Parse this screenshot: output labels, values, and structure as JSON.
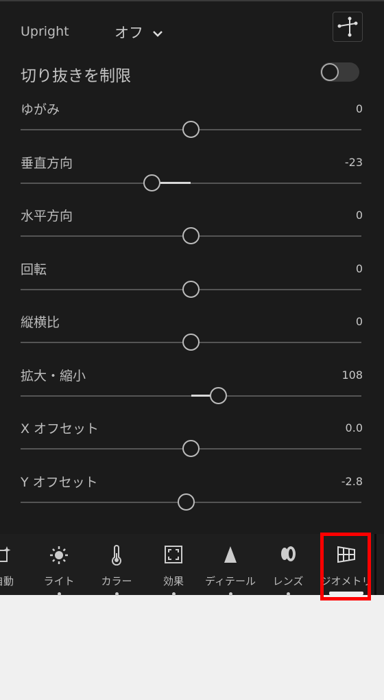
{
  "upright": {
    "label": "Upright",
    "value": "オフ"
  },
  "constrain_crop": {
    "label": "切り抜きを制限",
    "on": false
  },
  "sliders": [
    {
      "label": "ゆがみ",
      "value": "0",
      "num": 0,
      "min": -100,
      "max": 100
    },
    {
      "label": "垂直方向",
      "value": "-23",
      "num": -23,
      "min": -100,
      "max": 100
    },
    {
      "label": "水平方向",
      "value": "0",
      "num": 0,
      "min": -100,
      "max": 100
    },
    {
      "label": "回転",
      "value": "0",
      "num": 0,
      "min": -10,
      "max": 10
    },
    {
      "label": "縦横比",
      "value": "0",
      "num": 0,
      "min": -100,
      "max": 100
    },
    {
      "label": "拡大・縮小",
      "value": "108",
      "num": 108,
      "min": 50,
      "max": 150
    },
    {
      "label": "X オフセット",
      "value": "0.0",
      "num": 0,
      "min": -100,
      "max": 100
    },
    {
      "label": "Y オフセット",
      "value": "-2.8",
      "num": -2.8,
      "min": -100,
      "max": 100
    }
  ],
  "tabs": [
    {
      "label": "自動",
      "icon": "auto-icon"
    },
    {
      "label": "ライト",
      "icon": "sun-icon"
    },
    {
      "label": "カラー",
      "icon": "thermometer-icon"
    },
    {
      "label": "効果",
      "icon": "effects-icon"
    },
    {
      "label": "ディテール",
      "icon": "triangle-icon"
    },
    {
      "label": "レンズ",
      "icon": "lens-icon"
    },
    {
      "label": "ジオメトリ",
      "icon": "geometry-icon",
      "selected": true
    }
  ],
  "highlight_color": "#ff0000"
}
